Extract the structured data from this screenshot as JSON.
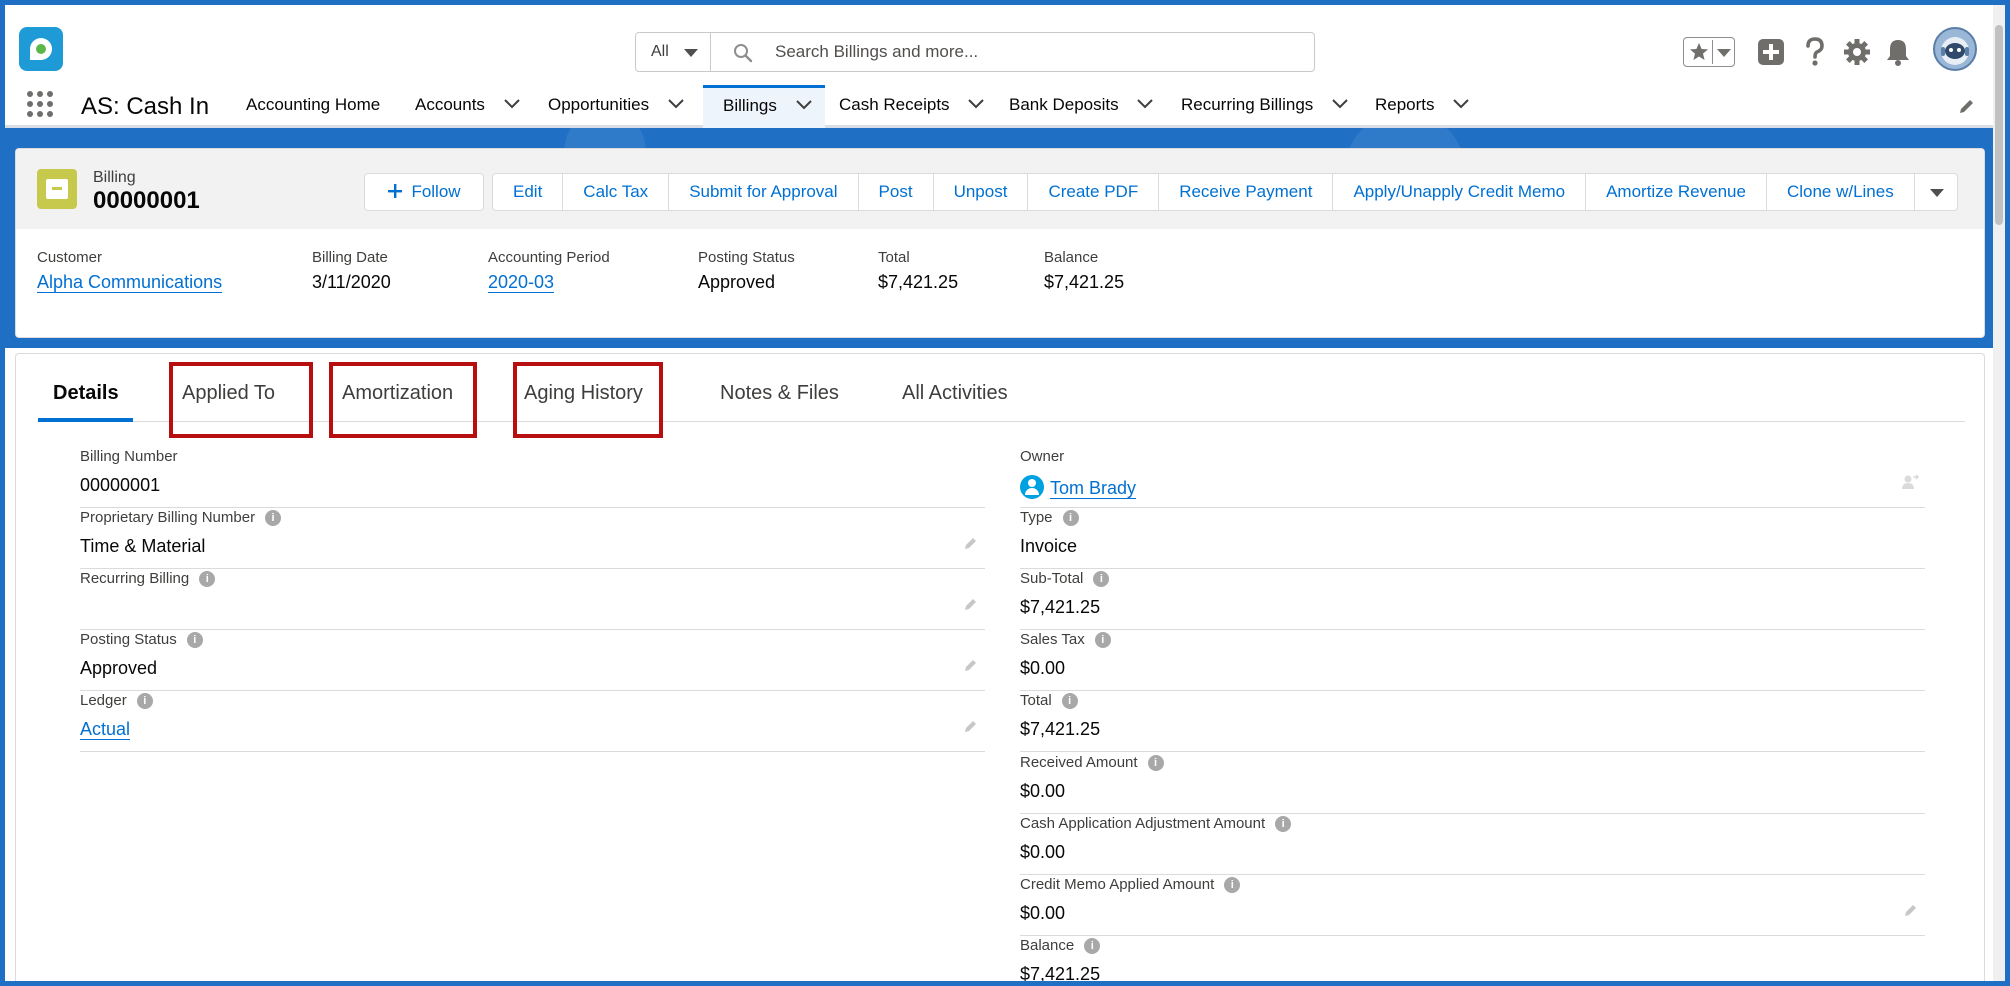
{
  "search": {
    "scope": "All",
    "placeholder": "Search Billings and more..."
  },
  "app": {
    "name": "AS: Cash In"
  },
  "nav": {
    "items": [
      {
        "label": "Accounting Home"
      },
      {
        "label": "Accounts"
      },
      {
        "label": "Opportunities"
      },
      {
        "label": "Billings"
      },
      {
        "label": "Cash Receipts"
      },
      {
        "label": "Bank Deposits"
      },
      {
        "label": "Recurring Billings"
      },
      {
        "label": "Reports"
      }
    ],
    "active": "Billings"
  },
  "record": {
    "object_label": "Billing",
    "title": "00000001",
    "follow_label": "Follow",
    "actions": [
      "Edit",
      "Calc Tax",
      "Submit for Approval",
      "Post",
      "Unpost",
      "Create PDF",
      "Receive Payment",
      "Apply/Unapply Credit Memo",
      "Amortize Revenue",
      "Clone w/Lines"
    ],
    "highlights": [
      {
        "label": "Customer",
        "value": "Alpha Communications"
      },
      {
        "label": "Billing Date",
        "value": "3/11/2020"
      },
      {
        "label": "Accounting Period",
        "value": "2020-03"
      },
      {
        "label": "Posting Status",
        "value": "Approved"
      },
      {
        "label": "Total",
        "value": "$7,421.25"
      },
      {
        "label": "Balance",
        "value": "$7,421.25"
      }
    ]
  },
  "tabs": {
    "items": [
      "Details",
      "Applied To",
      "Amortization",
      "Aging History",
      "Notes & Files",
      "All Activities"
    ],
    "active": "Details"
  },
  "details": {
    "left": [
      {
        "label": "Billing Number",
        "value": "00000001"
      },
      {
        "label": "Proprietary Billing Number",
        "value": "Time & Material"
      },
      {
        "label": "Recurring Billing",
        "value": ""
      },
      {
        "label": "Posting Status",
        "value": "Approved"
      },
      {
        "label": "Ledger",
        "value": "Actual"
      }
    ],
    "right": [
      {
        "label": "Owner",
        "value": "Tom Brady"
      },
      {
        "label": "Type",
        "value": "Invoice"
      },
      {
        "label": "Sub-Total",
        "value": "$7,421.25"
      },
      {
        "label": "Sales Tax",
        "value": "$0.00"
      },
      {
        "label": "Total",
        "value": "$7,421.25"
      },
      {
        "label": "Received Amount",
        "value": "$0.00"
      },
      {
        "label": "Cash Application Adjustment Amount",
        "value": "$0.00"
      },
      {
        "label": "Credit Memo Applied Amount",
        "value": "$0.00"
      },
      {
        "label": "Balance",
        "value": "$7,421.25"
      }
    ]
  },
  "colors": {
    "brand_blue": "#1f6fc5",
    "link": "#0070d2",
    "callout_red": "#b70f0f",
    "billing_icon": "#c7c94c"
  },
  "icons": {
    "header": [
      "star-icon",
      "add-icon",
      "help-icon",
      "gear-icon",
      "bell-icon"
    ]
  }
}
